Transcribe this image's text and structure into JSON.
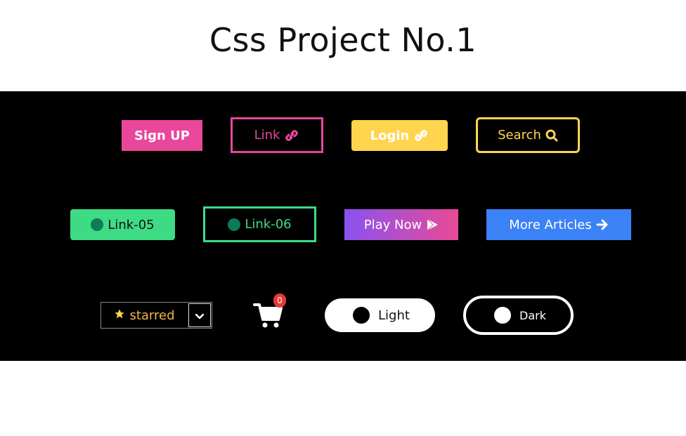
{
  "title": "Css Project No.1",
  "row1": {
    "signup": "Sign UP",
    "link": "Link",
    "login": "Login",
    "search": "Search"
  },
  "row2": {
    "link05": "Link-05",
    "link06": "Link-06",
    "play": "Play Now",
    "more": "More Articles"
  },
  "row3": {
    "starred": "starred",
    "cart_count": "0",
    "light": "Light",
    "dark": "Dark"
  },
  "colors": {
    "pink": "#e8479b",
    "yellow": "#ffd54f",
    "green": "#3ddc84",
    "blue": "#3b82f6"
  },
  "icons": [
    "link-icon",
    "search-icon",
    "play-icon",
    "arrow-right-icon",
    "star-icon",
    "chevron-down-icon",
    "cart-icon"
  ]
}
